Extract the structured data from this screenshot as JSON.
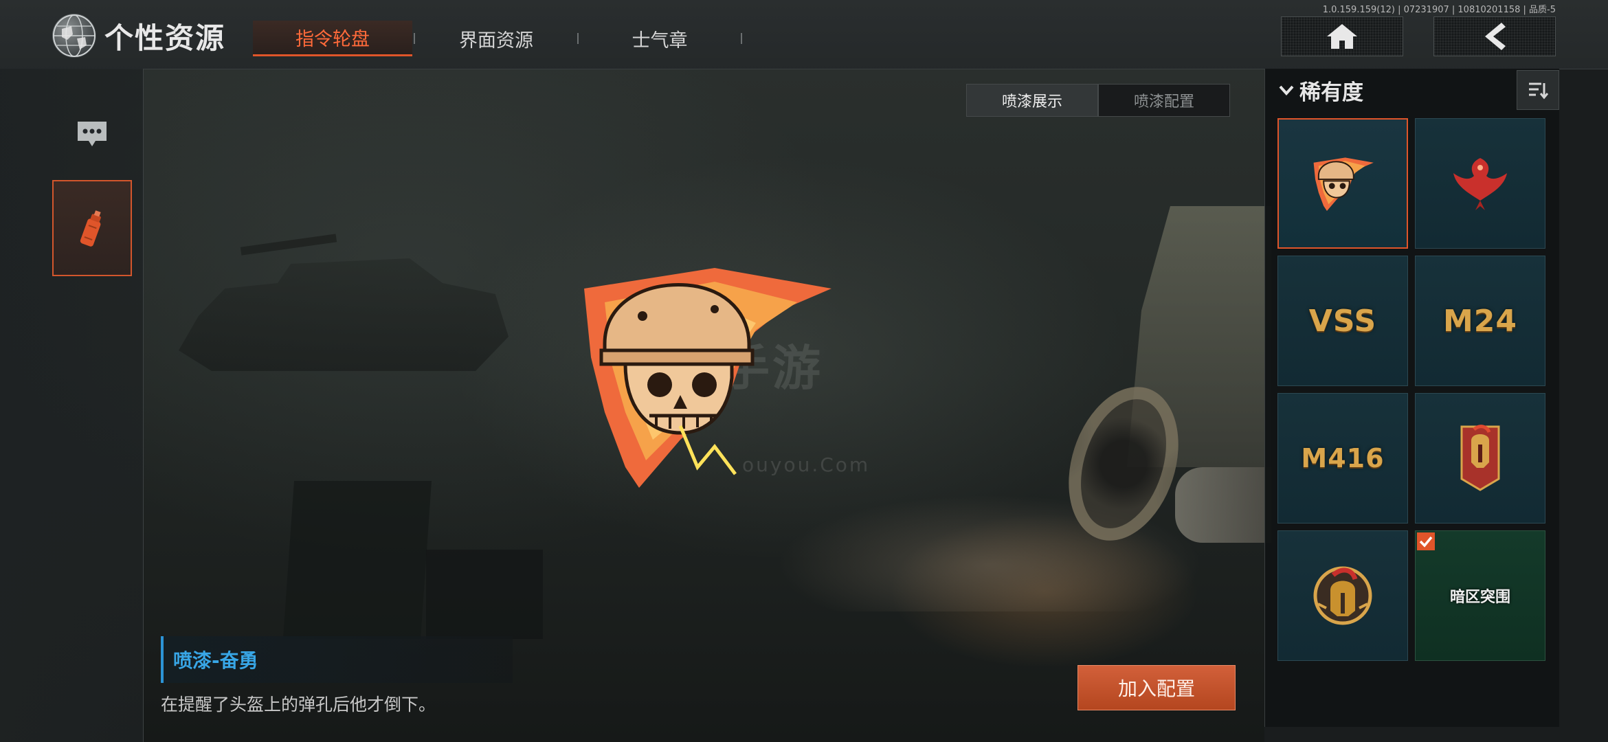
{
  "header": {
    "title": "个性资源",
    "version": "1.0.159.159(12) | 07231907 | 10810201158 | 品质-5",
    "tabs": [
      {
        "label": "指令轮盘",
        "active": true
      },
      {
        "label": "界面资源",
        "active": false
      },
      {
        "label": "士气章",
        "active": false
      }
    ],
    "home_icon": "home-icon",
    "back_icon": "back-arrow-icon"
  },
  "sidebar": {
    "items": [
      {
        "icon": "chat-bubble-icon",
        "active": false
      },
      {
        "icon": "spray-can-icon",
        "active": true
      }
    ]
  },
  "subtabs": [
    {
      "label": "喷漆展示",
      "active": true
    },
    {
      "label": "喷漆配置",
      "active": false
    }
  ],
  "watermark": {
    "main": "手游",
    "sub": "ouyou.Com"
  },
  "preview": {
    "icon": "flaming-helmet-skull-spray"
  },
  "detail": {
    "name": "喷漆-奋勇",
    "description": "在提醒了头盔上的弹孔后他才倒下。",
    "add_label": "加入配置"
  },
  "right_panel": {
    "filter_label": "稀有度",
    "sort_icon": "sort-icon",
    "items": [
      {
        "icon": "flaming-helmet-skull-spray",
        "selected": true,
        "equipped": false
      },
      {
        "icon": "red-phoenix-spray",
        "selected": false,
        "equipped": false
      },
      {
        "icon": "vss-rifle-spray",
        "text": "VSS",
        "selected": false,
        "equipped": false
      },
      {
        "icon": "m24-rifle-spray",
        "text": "M24",
        "selected": false,
        "equipped": false
      },
      {
        "icon": "m416-rifle-spray",
        "text": "M416",
        "selected": false,
        "equipped": false
      },
      {
        "icon": "spartan-helmet-banner-spray",
        "selected": false,
        "equipped": false
      },
      {
        "icon": "spartan-helmet-emblem-spray",
        "selected": false,
        "equipped": false
      },
      {
        "icon": "dark-zone-logo-spray",
        "text": "暗区突围",
        "selected": false,
        "equipped": true
      }
    ]
  },
  "colors": {
    "accent": "#e0552a",
    "title_blue": "#38a6e6",
    "panel_bg": "#111415",
    "cell_bg": "#17313a"
  }
}
